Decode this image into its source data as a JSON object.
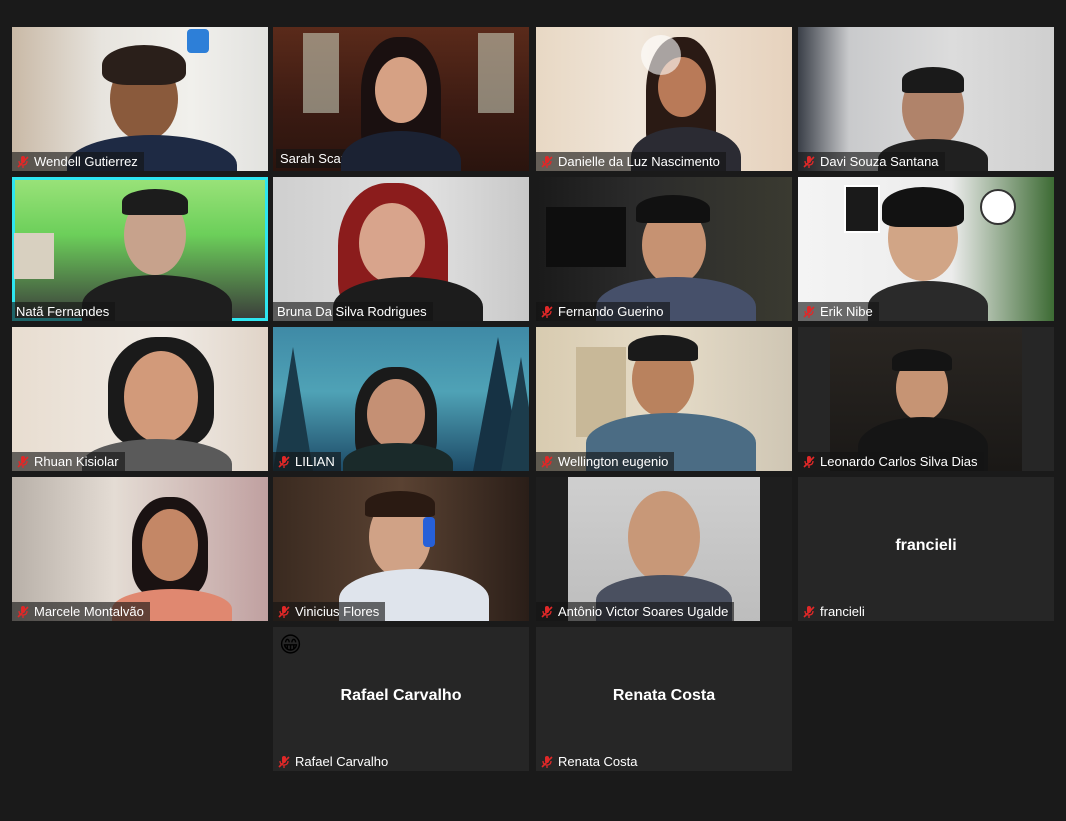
{
  "participants": [
    {
      "name": "Wendell Gutierrez",
      "muted": true
    },
    {
      "name": "Sarah Scardini",
      "muted": false,
      "active_speaker": true
    },
    {
      "name": "Danielle da Luz Nascimento",
      "muted": true
    },
    {
      "name": "Davi Souza Santana",
      "muted": true
    },
    {
      "name": "Natã Fernandes",
      "muted": false
    },
    {
      "name": "Bruna Da Silva Rodrigues",
      "muted": false
    },
    {
      "name": "Fernando Guerino",
      "muted": true
    },
    {
      "name": "Erik Nibe",
      "muted": true
    },
    {
      "name": "Rhuan Kisiolar",
      "muted": true
    },
    {
      "name": "LILIAN",
      "muted": true
    },
    {
      "name": "Wellington eugenio",
      "muted": true
    },
    {
      "name": "Leonardo Carlos Silva Dias",
      "muted": true
    },
    {
      "name": "Marcele Montalvão",
      "muted": true
    },
    {
      "name": "Vinicius Flores",
      "muted": true
    },
    {
      "name": "Antônio Victor Soares Ugalde",
      "muted": true
    },
    {
      "name": "francieli",
      "muted": true,
      "video_off": true,
      "center_label": "francieli"
    },
    {
      "name": "Rafael Carvalho",
      "muted": true,
      "video_off": true,
      "center_label": "Rafael Carvalho",
      "reaction": "😁"
    },
    {
      "name": "Renata Costa",
      "muted": true,
      "video_off": true,
      "center_label": "Renata Costa"
    }
  ],
  "colors": {
    "background": "#1a1a1a",
    "tile_off": "#262626",
    "active_speaker_border": "#e9f58a",
    "mic_off": "#e02828"
  }
}
